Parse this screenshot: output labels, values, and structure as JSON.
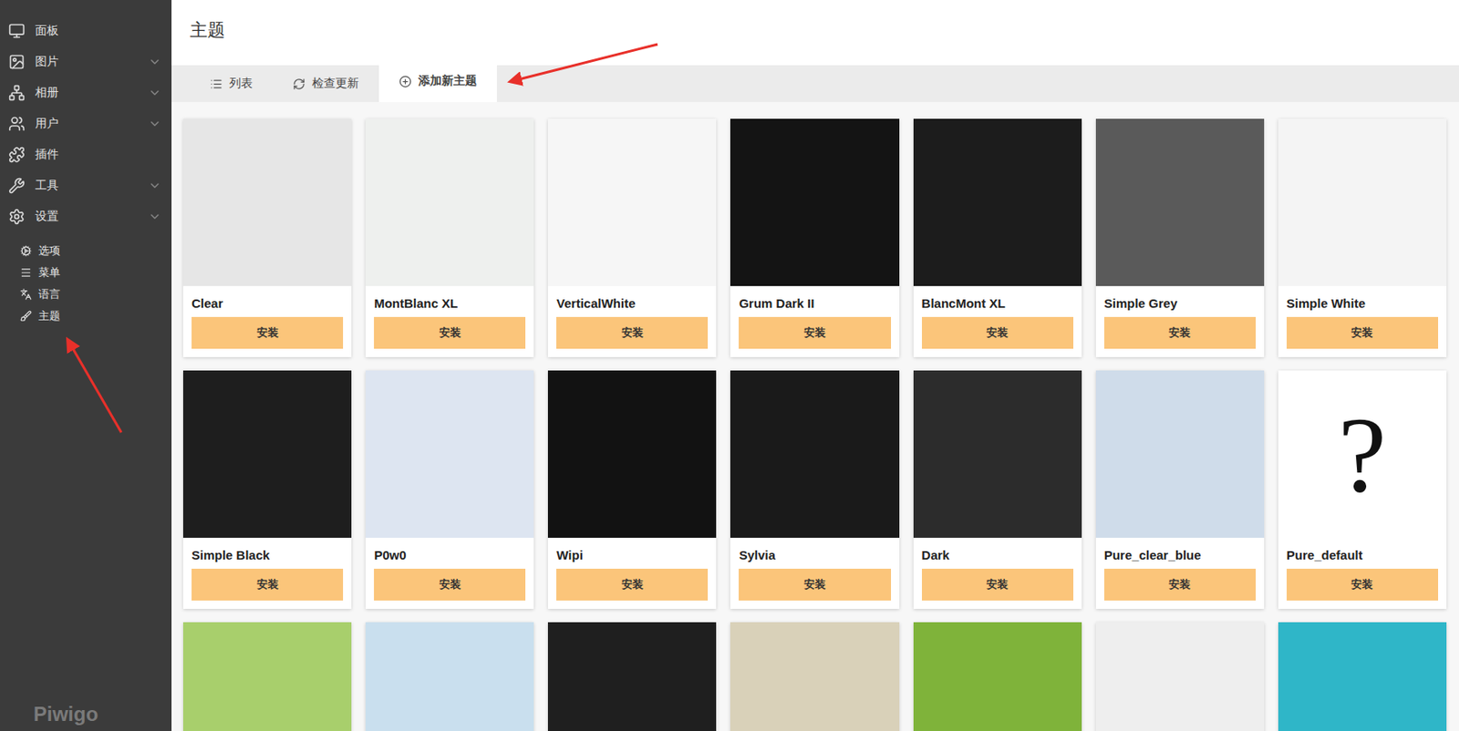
{
  "sidebar": {
    "items": [
      {
        "label": "面板",
        "expandable": false
      },
      {
        "label": "图片",
        "expandable": true
      },
      {
        "label": "相册",
        "expandable": true
      },
      {
        "label": "用户",
        "expandable": true
      },
      {
        "label": "插件",
        "expandable": false
      },
      {
        "label": "工具",
        "expandable": true
      },
      {
        "label": "设置",
        "expandable": true
      }
    ],
    "subitems": [
      {
        "label": "选项"
      },
      {
        "label": "菜单"
      },
      {
        "label": "语言"
      },
      {
        "label": "主题"
      }
    ],
    "logo": "Piwigo"
  },
  "page": {
    "title": "主题"
  },
  "tabs": [
    {
      "label": "列表",
      "selected": false
    },
    {
      "label": "检查更新",
      "selected": false
    },
    {
      "label": "添加新主题",
      "selected": true
    }
  ],
  "themes": [
    {
      "name": "Clear",
      "button": "安装",
      "color": "#e6e6e6"
    },
    {
      "name": "MontBlanc XL",
      "button": "安装",
      "color": "#eef0ee"
    },
    {
      "name": "VerticalWhite",
      "button": "安装",
      "color": "#f6f6f6"
    },
    {
      "name": "Grum Dark II",
      "button": "安装",
      "color": "#141414"
    },
    {
      "name": "BlancMont XL",
      "button": "安装",
      "color": "#1c1c1c"
    },
    {
      "name": "Simple Grey",
      "button": "安装",
      "color": "#5a5a5a"
    },
    {
      "name": "Simple White",
      "button": "安装",
      "color": "#f4f4f4"
    },
    {
      "name": "Simple Black",
      "button": "安装",
      "color": "#1e1e1e"
    },
    {
      "name": "P0w0",
      "button": "安装",
      "color": "#dde5f1"
    },
    {
      "name": "Wipi",
      "button": "安装",
      "color": "#121212"
    },
    {
      "name": "Sylvia",
      "button": "安装",
      "color": "#1a1a1a"
    },
    {
      "name": "Dark",
      "button": "安装",
      "color": "#2c2c2c"
    },
    {
      "name": "Pure_clear_blue",
      "button": "安装",
      "color": "#cfdcea"
    },
    {
      "name": "Pure_default",
      "button": "安装",
      "color": "#ffffff",
      "placeholder": "?"
    }
  ],
  "more_previews": [
    {
      "color": "#a8cf6c"
    },
    {
      "color": "#c9dfee"
    },
    {
      "color": "#1f1f1f"
    },
    {
      "color": "#d9d1b9"
    },
    {
      "color": "#7fb33a"
    },
    {
      "color": "#eeeeee"
    },
    {
      "color": "#2fb6c8"
    }
  ]
}
